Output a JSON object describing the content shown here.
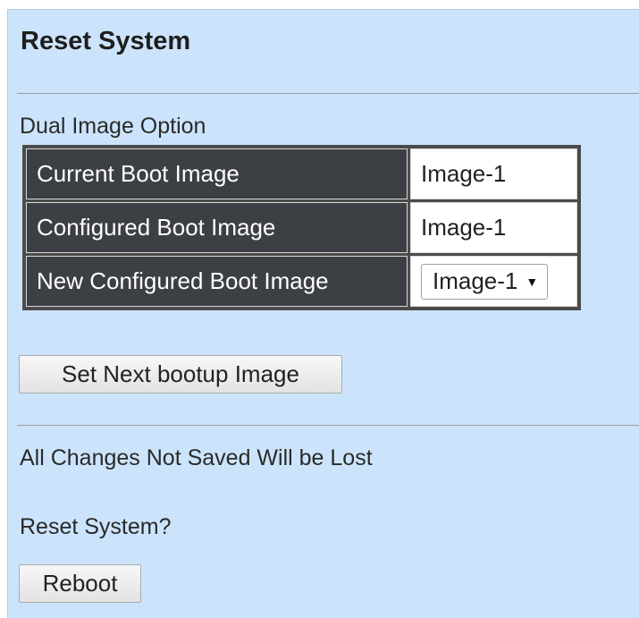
{
  "page": {
    "title": "Reset System"
  },
  "dual_image": {
    "section_label": "Dual Image Option",
    "rows": [
      {
        "label": "Current Boot Image",
        "value": "Image-1"
      },
      {
        "label": "Configured Boot Image",
        "value": "Image-1"
      },
      {
        "label": "New Configured Boot Image",
        "value": "Image-1"
      }
    ],
    "select_caret_icon": "caret-down-icon",
    "set_button_label": "Set Next bootup Image"
  },
  "reset": {
    "warning": "All Changes Not Saved Will be Lost",
    "question": "Reset System?",
    "reboot_label": "Reboot"
  },
  "colors": {
    "panel_background": "#cce4fb",
    "label_cell_background": "#3c3f43",
    "value_cell_background": "#ffffff"
  }
}
